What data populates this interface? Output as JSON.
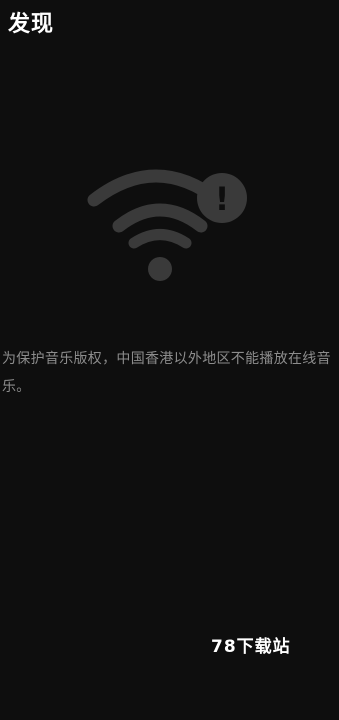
{
  "header": {
    "title": "发现"
  },
  "main": {
    "illustration": {
      "icon": "wifi-alert-icon",
      "badge_glyph": "!"
    },
    "notice_text": "为保护音乐版权，中国香港以外地区不能播放在线音乐。"
  },
  "watermark": {
    "text": "78下载站"
  },
  "colors": {
    "background": "#0e0e0e",
    "title": "#ffffff",
    "icon": "#3a3a3a",
    "notice_text": "#8c8c8c"
  }
}
